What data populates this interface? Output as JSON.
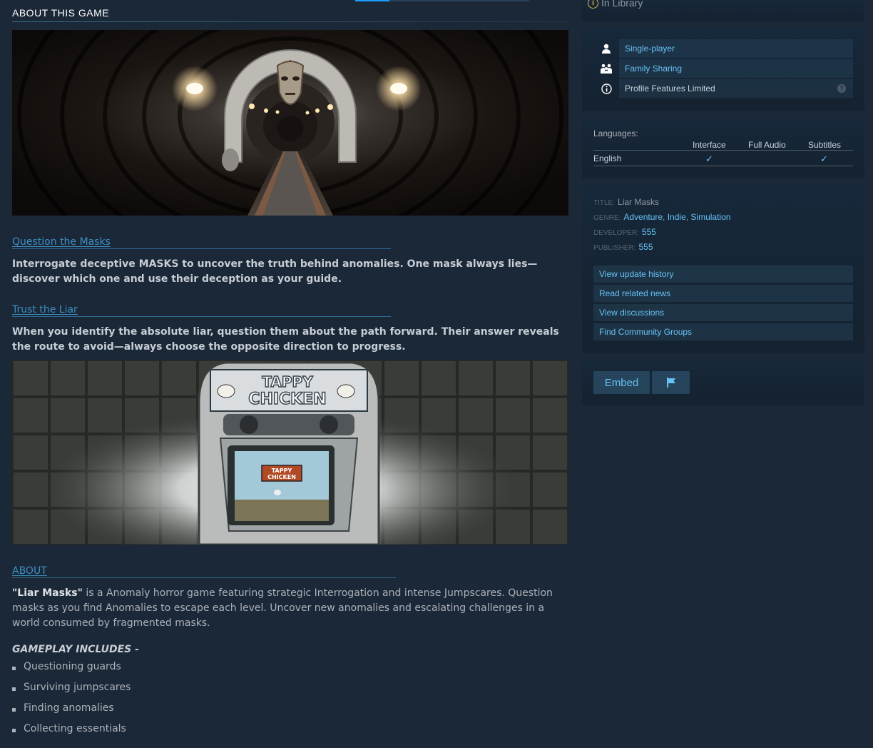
{
  "about": {
    "section_title": "ABOUT THIS GAME",
    "heading_question": "Question the Masks",
    "para_question": "Interrogate deceptive MASKS to uncover the truth behind anomalies. One mask always lies—discover which one and use their deception as your guide.",
    "heading_trust": "Trust the Liar",
    "para_trust": "When you identify the absolute liar, question them about the path forward. Their answer reveals the route to avoid—always choose the opposite direction to progress.",
    "heading_about": "ABOUT",
    "about_game_name": "\"Liar Masks\"",
    "about_text": " is a Anomaly horror game featuring strategic Interrogation and intense Jumpscares. Question masks as you find Anomalies to escape each level. Uncover new anomalies and escalating challenges in a world consumed by fragmented masks.",
    "gameplay_title": "GAMEPLAY INCLUDES -",
    "gameplay_items": [
      "Questioning guards",
      "Surviving jumpscares",
      "Finding anomalies",
      "Collecting essentials"
    ],
    "screenshot2_title": "TAPPY CHICKEN",
    "screenshot2_title_line1": "TAPPY",
    "screenshot2_title_line2": "CHICKEN"
  },
  "sidebar": {
    "in_library": "In Library",
    "features": [
      {
        "label": "Single-player",
        "icon": "single-player-icon"
      },
      {
        "label": "Family Sharing",
        "icon": "family-sharing-icon"
      },
      {
        "label": "Profile Features Limited",
        "icon": "info-icon",
        "help": "?"
      }
    ],
    "languages": {
      "title": "Languages:",
      "columns": [
        "Interface",
        "Full Audio",
        "Subtitles"
      ],
      "rows": [
        {
          "name": "English",
          "interface": "✓",
          "full_audio": "",
          "subtitles": "✓"
        }
      ]
    },
    "details": {
      "title_label": "TITLE:",
      "title_value": "Liar Masks",
      "genre_label": "GENRE:",
      "genres": [
        "Adventure",
        "Indie",
        "Simulation"
      ],
      "developer_label": "DEVELOPER:",
      "developer": "555",
      "publisher_label": "PUBLISHER:",
      "publisher": "555"
    },
    "links": [
      "View update history",
      "Read related news",
      "View discussions",
      "Find Community Groups"
    ],
    "embed_label": "Embed"
  },
  "colors": {
    "background": "#1b2838",
    "link": "#67c1f5",
    "heading_link": "#3d8fc2"
  }
}
